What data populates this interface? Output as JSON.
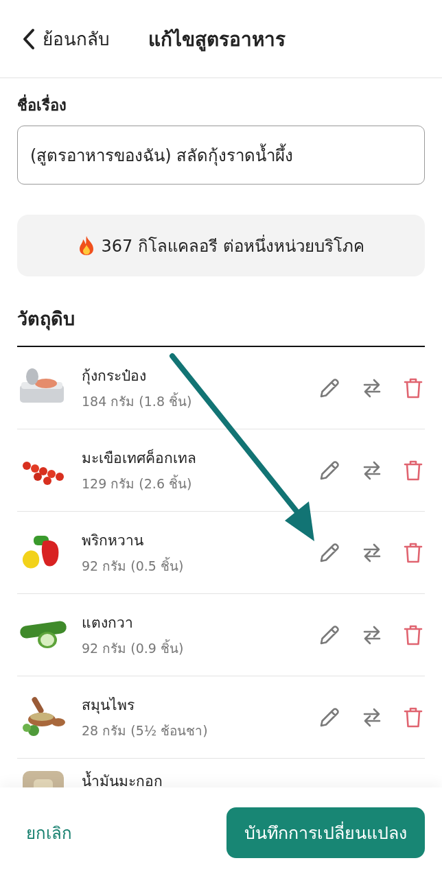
{
  "header": {
    "back": "ย้อนกลับ",
    "title": "แก้ไขสูตรอาหาร"
  },
  "title_field": {
    "label": "ชื่อเรื่อง",
    "value": "(สูตรอาหารของฉัน) สลัดกุ้งราดน้ำผึ้ง"
  },
  "calories": {
    "text": "367 กิโลแคลอรี ต่อหนึ่งหน่วยบริโภค"
  },
  "ingredients": {
    "heading": "วัตถุดิบ",
    "items": [
      {
        "name": "กุ้งกระป๋อง",
        "amount": "184 กรัม (1.8 ชิ้น)"
      },
      {
        "name": "มะเขือเทศค็อกเทล",
        "amount": "129 กรัม (2.6 ชิ้น)"
      },
      {
        "name": "พริกหวาน",
        "amount": "92 กรัม (0.5 ชิ้น)"
      },
      {
        "name": "แตงกวา",
        "amount": "92 กรัม (0.9 ชิ้น)"
      },
      {
        "name": "สมุนไพร",
        "amount": "28 กรัม (5½ ช้อนชา)"
      },
      {
        "name": "น้ำมันมะกอก"
      }
    ]
  },
  "footer": {
    "cancel": "ยกเลิก",
    "save": "บันทึกการเปลี่ยนแปลง"
  }
}
